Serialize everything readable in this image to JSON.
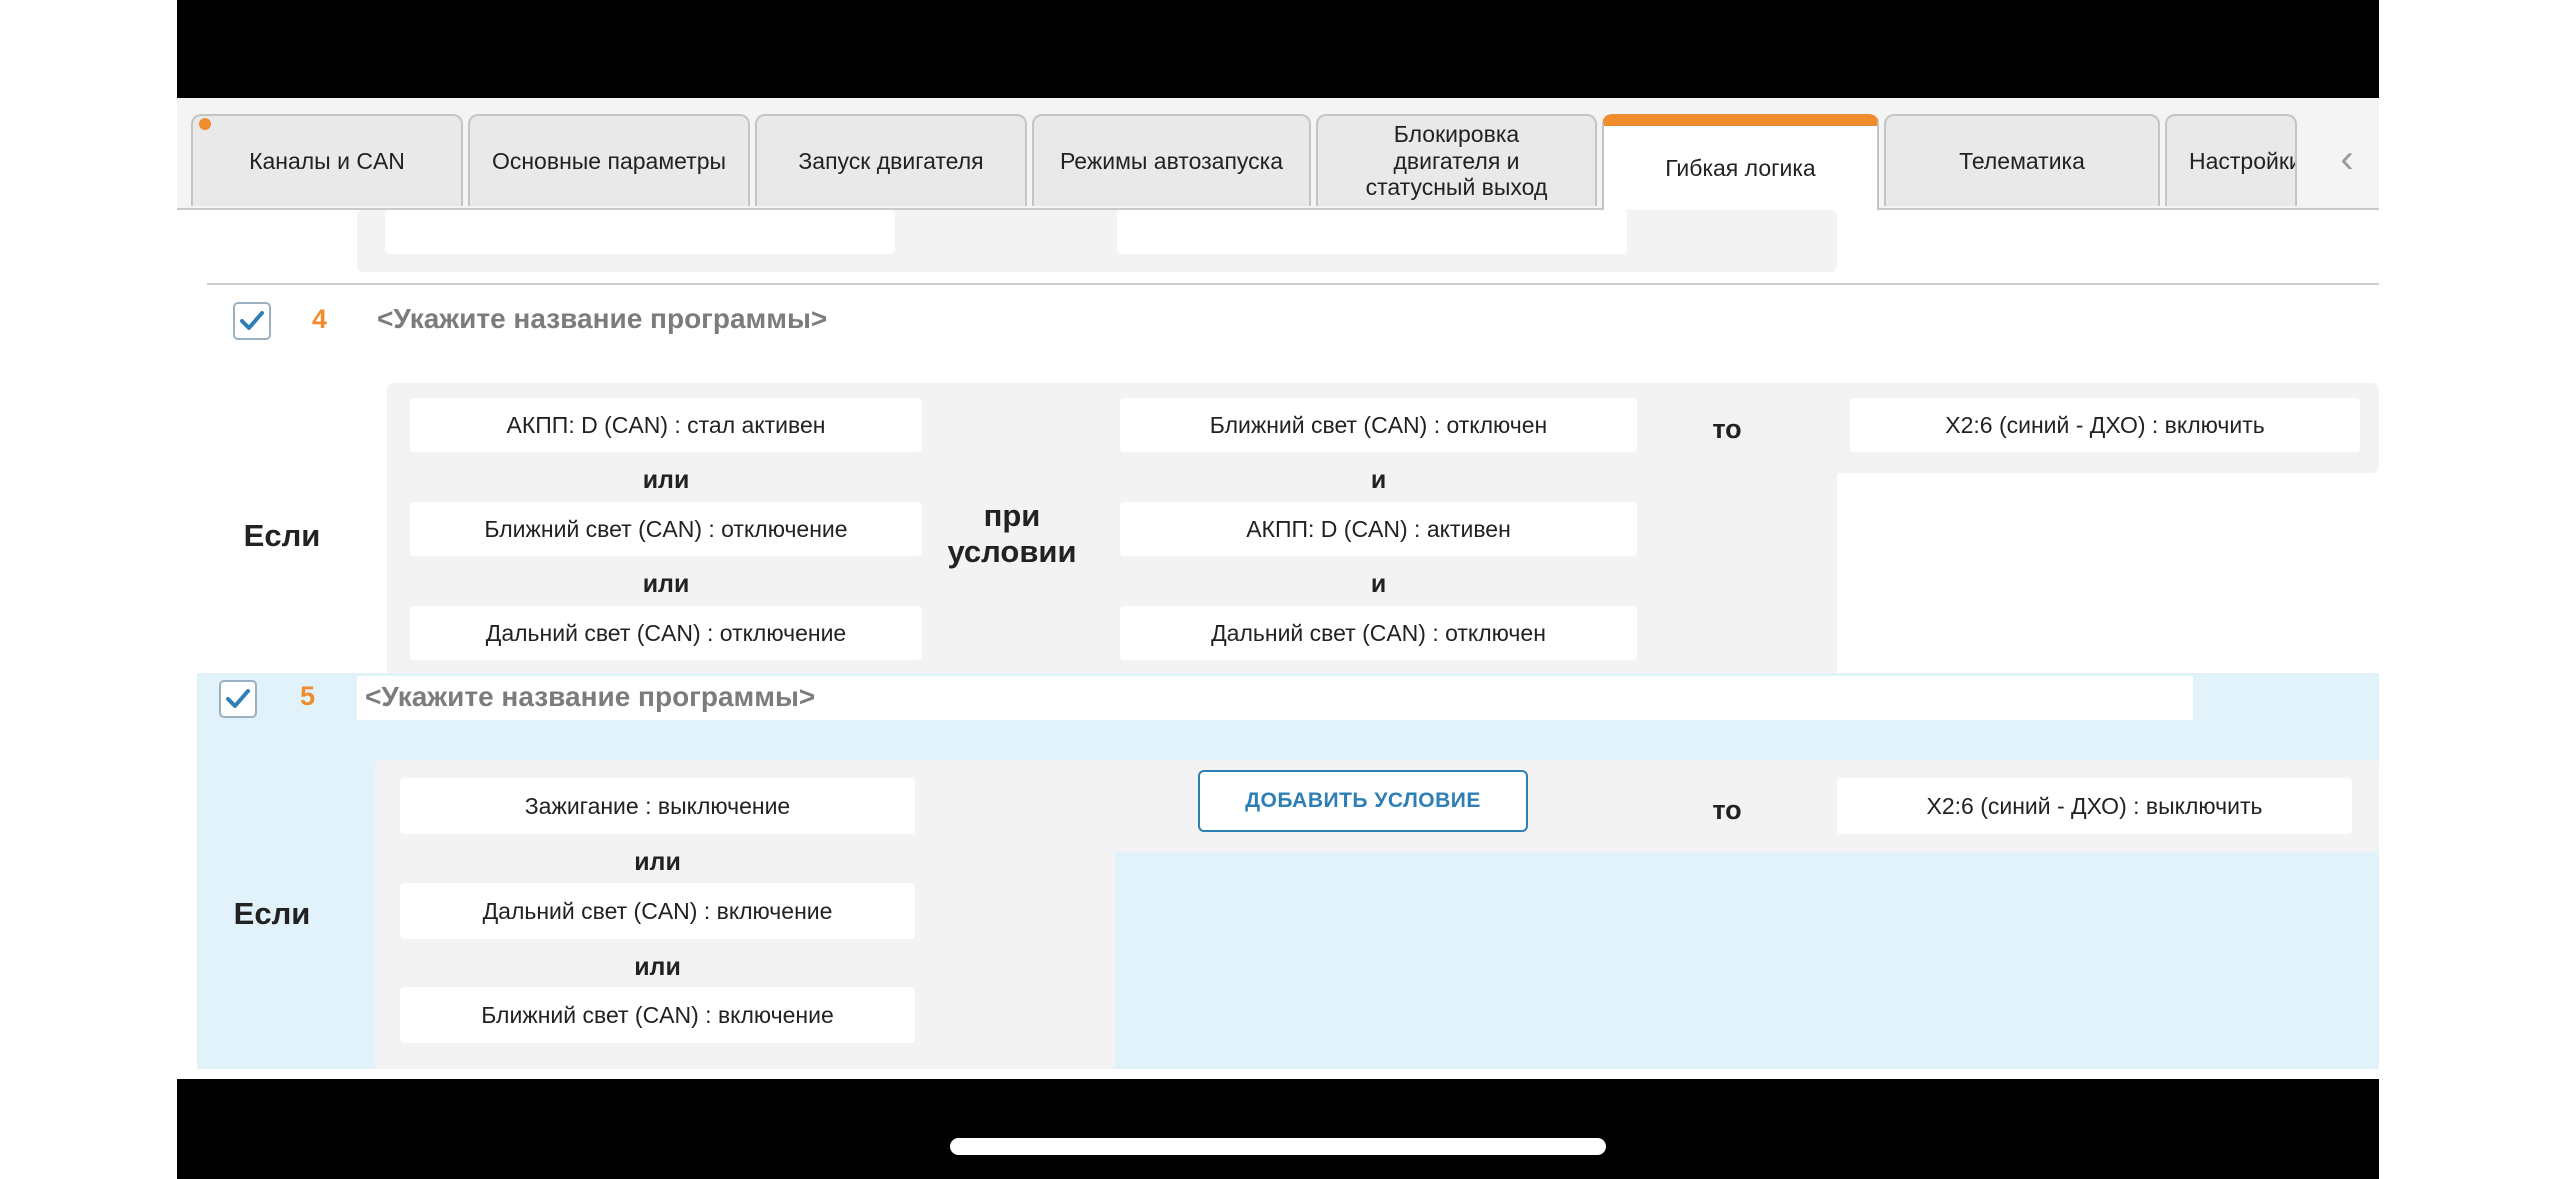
{
  "tabs": [
    {
      "label": "Каналы и CAN",
      "active": false,
      "has_indicator": true
    },
    {
      "label": "Основные параметры",
      "active": false
    },
    {
      "label": "Запуск двигателя",
      "active": false
    },
    {
      "label": "Режимы автозапуска",
      "active": false
    },
    {
      "label": "Блокировка двигателя и статусный выход",
      "active": false
    },
    {
      "label": "Гибкая логика",
      "active": true,
      "has_indicator": true
    },
    {
      "label": "Телематика",
      "active": false
    },
    {
      "label": "Настройки",
      "active": false
    }
  ],
  "tab_scroll_icon": "chevron-left-icon",
  "labels": {
    "if": "Если",
    "when": "при условии",
    "then": "то",
    "or": "или",
    "and": "и"
  },
  "accent_colors": {
    "orange": "#ef8c2e",
    "blue": "#2e7fb5",
    "selected_bg": "#e2f2fb"
  },
  "programs": [
    {
      "number": "4",
      "checked": true,
      "name": "<Укажите название программы>",
      "if_conditions": [
        "АКПП: D (CAN) : стал активен",
        "Ближний свет (CAN) : отключение",
        "Дальний свет (CAN) : отключение"
      ],
      "when_conditions": [
        "Ближний свет (CAN) : отключен",
        "АКПП: D (CAN) : активен",
        "Дальний свет (CAN) : отключен"
      ],
      "actions": [
        "X2:6 (синий - ДХО) : включить"
      ]
    },
    {
      "number": "5",
      "checked": true,
      "selected": true,
      "name": "<Укажите название программы>",
      "if_conditions": [
        "Зажигание : выключение",
        "Дальний свет (CAN) : включение",
        "Ближний свет (CAN) : включение"
      ],
      "add_condition_label": "ДОБАВИТЬ УСЛОВИЕ",
      "actions": [
        "X2:6 (синий - ДХО) : выключить"
      ]
    }
  ]
}
